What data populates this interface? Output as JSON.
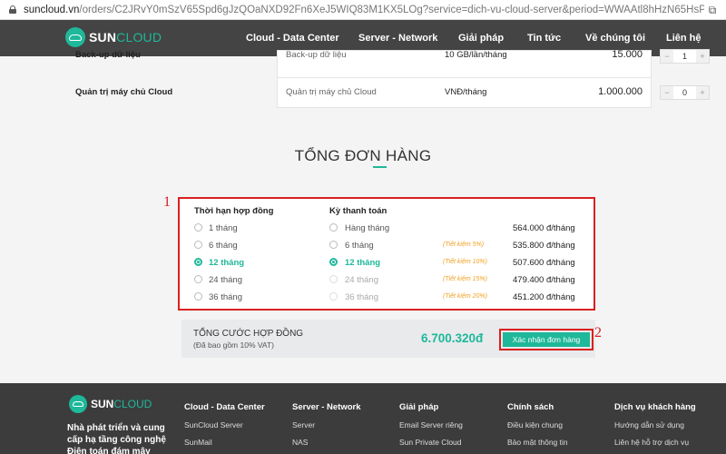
{
  "browser": {
    "url_host": "suncloud.vn",
    "url_rest": "/orders/C2JRvY0mSzV65Spd6gJzQOaNXD92Fn6XeJ5WIQ83M1KX5LOg?service=dich-vu-cloud-server&period=WWAAtl8hHzN65HsPvQJzQJ2OoL..."
  },
  "nav": {
    "brand_main": "SUN",
    "brand_accent": "CLOUD",
    "items": [
      "Cloud - Data Center",
      "Server - Network",
      "Giải pháp",
      "Tin tức",
      "Về chúng tôi",
      "Liên hệ"
    ]
  },
  "services": [
    {
      "name": "Back-up dữ liệu",
      "desc": "Back-up dữ liệu",
      "unit": "10 GB/lần/tháng",
      "price": "15.000",
      "qty": "1"
    },
    {
      "name": "Quản trị máy chủ Cloud",
      "desc": "Quản trị máy chủ Cloud",
      "unit": "VNĐ/tháng",
      "price": "1.000.000",
      "qty": "0"
    }
  ],
  "summary": {
    "title": "TỔNG ĐƠN HÀNG",
    "term_header": "Thời hạn hợp đồng",
    "cycle_header": "Kỳ thanh toán",
    "options": [
      {
        "term": "1 tháng",
        "cycle": "Hàng tháng",
        "saving": "",
        "price": "564.000 đ/tháng",
        "state": "normal"
      },
      {
        "term": "6 tháng",
        "cycle": "6 tháng",
        "saving": "(Tiết kiệm 5%)",
        "price": "535.800 đ/tháng",
        "state": "normal"
      },
      {
        "term": "12 tháng",
        "cycle": "12 tháng",
        "saving": "(Tiết kiệm 10%)",
        "price": "507.600 đ/tháng",
        "state": "selected"
      },
      {
        "term": "24 tháng",
        "cycle": "24 tháng",
        "saving": "(Tiết kiệm 15%)",
        "price": "479.400 đ/tháng",
        "state": "dim"
      },
      {
        "term": "36 tháng",
        "cycle": "36 tháng",
        "saving": "(Tiết kiệm 20%)",
        "price": "451.200 đ/tháng",
        "state": "dim"
      }
    ],
    "total_label": "TỔNG CƯỚC HỢP ĐỒNG",
    "total_note": "(Đã bao gồm 10% VAT)",
    "total_amount": "6.700.320đ",
    "confirm_label": "Xác nhận đơn hàng"
  },
  "annotations": {
    "one": "1",
    "two": "2"
  },
  "footer": {
    "brand_main": "SUN",
    "brand_accent": "CLOUD",
    "tagline": "Nhà phát triển và cung cấp hạ tầng công nghệ Điện toán đám mây",
    "columns": [
      {
        "head": "Cloud - Data Center",
        "items": [
          "SunCloud Server",
          "SunMail"
        ]
      },
      {
        "head": "Server - Network",
        "items": [
          "Server",
          "NAS"
        ]
      },
      {
        "head": "Giải pháp",
        "items": [
          "Email Server riêng",
          "Sun Private Cloud"
        ]
      },
      {
        "head": "Chính sách",
        "items": [
          "Điều kiện chung",
          "Bảo mật thông tin"
        ]
      },
      {
        "head": "Dịch vụ khách hàng",
        "items": [
          "Hướng dẫn sử dụng",
          "Liên hệ hỗ trợ dịch vụ"
        ]
      }
    ]
  },
  "colors": {
    "accent": "#1fb89a",
    "annotation": "#d92020",
    "nav_bg": "#444444",
    "footer_bg": "#3c3c3c"
  }
}
